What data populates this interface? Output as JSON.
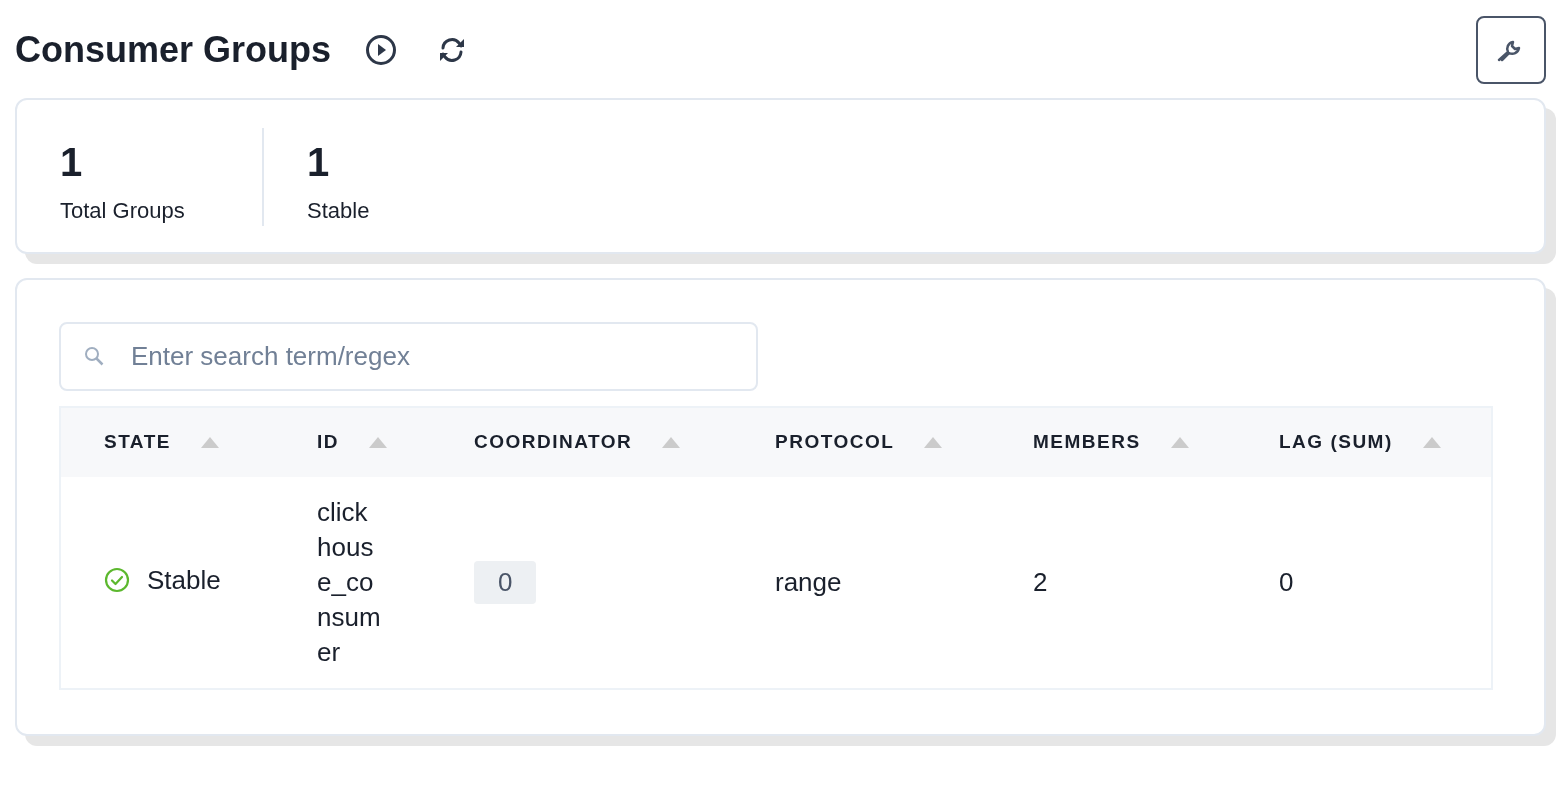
{
  "title": "Consumer Groups",
  "stats": [
    {
      "value": "1",
      "label": "Total Groups"
    },
    {
      "value": "1",
      "label": "Stable"
    }
  ],
  "search": {
    "placeholder": "Enter search term/regex"
  },
  "table": {
    "columns": [
      "STATE",
      "ID",
      "COORDINATOR",
      "PROTOCOL",
      "MEMBERS",
      "LAG (SUM)"
    ],
    "rows": [
      {
        "state": {
          "kind": "stable",
          "label": "Stable"
        },
        "id": "clickhouse_consumer",
        "coordinator": "0",
        "protocol": "range",
        "members": "2",
        "lag": "0"
      }
    ]
  }
}
